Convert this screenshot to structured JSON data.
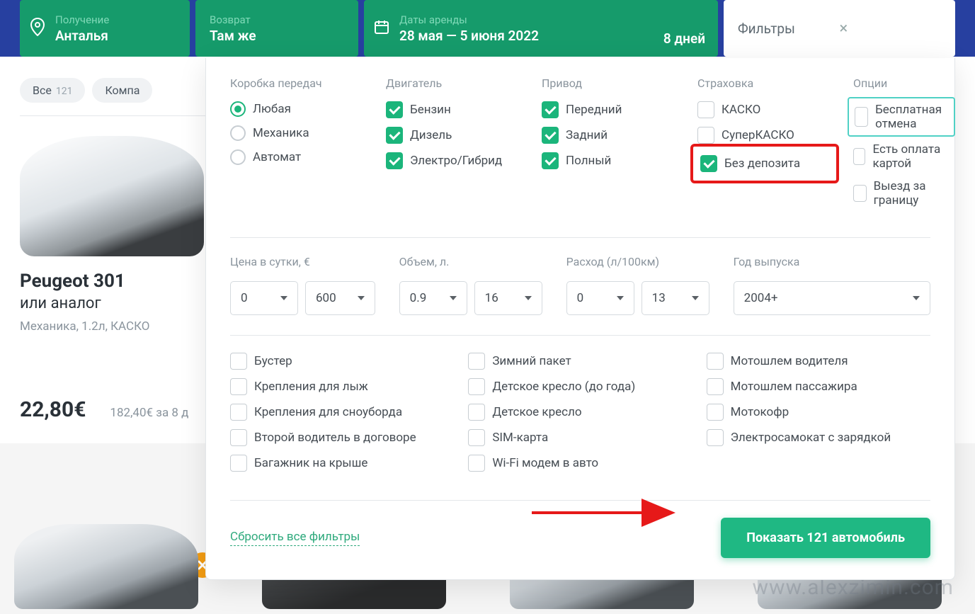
{
  "top": {
    "pickup_label": "Получение",
    "pickup_value": "Анталья",
    "return_label": "Возврат",
    "return_value": "Там же",
    "dates_label": "Даты аренды",
    "dates_value": "28 мая — 5 июня 2022",
    "days": "8 дней",
    "filters_placeholder": "Фильтры"
  },
  "chips": {
    "all": "Все",
    "all_count": "121",
    "compact": "Компа"
  },
  "car": {
    "title": "Peugeot 301",
    "sub": "или аналог",
    "specs": "Механика, 1.2л, КАСКО",
    "price": "22,80€",
    "price_sub": "182,40€ за 8 д"
  },
  "filters": {
    "gearbox": {
      "h": "Коробка передач",
      "any": "Любая",
      "manual": "Механика",
      "auto": "Автомат"
    },
    "engine": {
      "h": "Двигатель",
      "petrol": "Бензин",
      "diesel": "Дизель",
      "hybrid": "Электро/Гибрид"
    },
    "drive": {
      "h": "Привод",
      "front": "Передний",
      "rear": "Задний",
      "full": "Полный"
    },
    "insurance": {
      "h": "Страховка",
      "kasko": "КАСКО",
      "super": "СуперКАСКО",
      "nodep": "Без депозита"
    },
    "options": {
      "h": "Опции",
      "cancel": "Бесплатная отмена",
      "card": "Есть оплата картой",
      "border": "Выезд за границу"
    }
  },
  "ranges": {
    "price": {
      "h": "Цена в сутки, €",
      "min": "0",
      "max": "600"
    },
    "vol": {
      "h": "Объем, л.",
      "min": "0.9",
      "max": "16"
    },
    "cons": {
      "h": "Расход (л/100км)",
      "min": "0",
      "max": "13"
    },
    "year": {
      "h": "Год выпуска",
      "val": "2004+"
    }
  },
  "addons": {
    "c1": [
      "Бустер",
      "Крепления для лыж",
      "Крепления для сноуборда",
      "Второй водитель в договоре",
      "Багажник на крыше"
    ],
    "c2": [
      "Зимний пакет",
      "Детское кресло (до года)",
      "Детское кресло",
      "SIM-карта",
      "Wi-Fi модем в авто"
    ],
    "c3": [
      "Мотошлем водителя",
      "Мотошлем пассажира",
      "Мотокофр",
      "Электросамокат с зарядкой"
    ]
  },
  "reset": "Сбросить все фильтры",
  "show": "Показать 121 автомобиль",
  "watermark": "www.alexzimin.com"
}
